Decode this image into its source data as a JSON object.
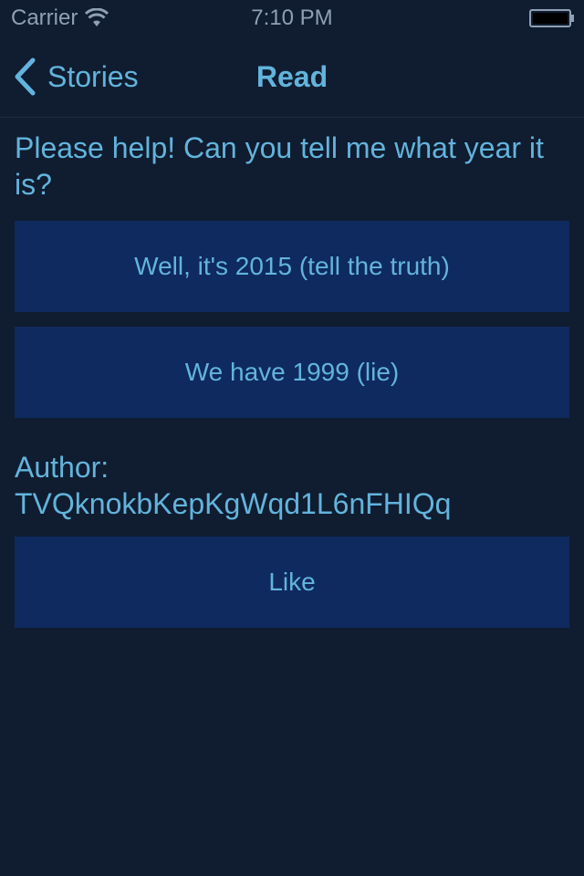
{
  "status_bar": {
    "carrier": "Carrier",
    "time": "7:10 PM"
  },
  "nav": {
    "back_label": "Stories",
    "title": "Read"
  },
  "story": {
    "question": "Please help! Can you tell me what year it is?",
    "choices": [
      {
        "label": "Well, it's 2015 (tell the truth)"
      },
      {
        "label": "We have 1999 (lie)"
      }
    ],
    "author_label": "Author:",
    "author_id": "TVQknokbKepKgWqd1L6nFHIQq",
    "like_label": "Like"
  },
  "colors": {
    "background": "#101c30",
    "accent": "#62b4dc",
    "button_bg": "#0f2a5e"
  }
}
